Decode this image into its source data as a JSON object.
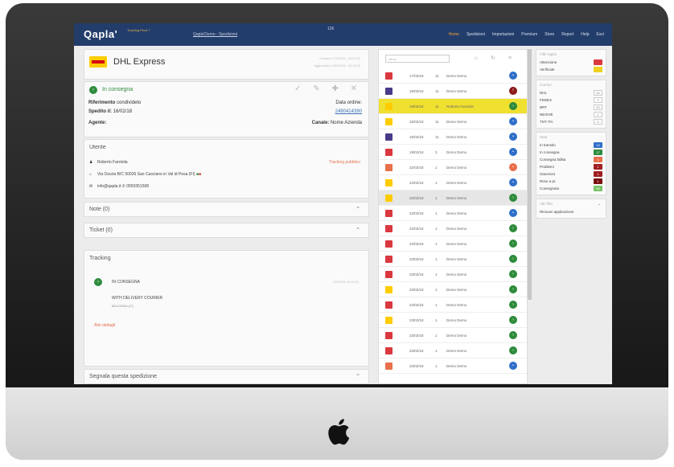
{
  "app": {
    "logo": "Qapla'",
    "logo_sub": "Tracking Pivot 7",
    "breadcrumb": "Qapla'Demo - Spedizioni",
    "user_no": "126",
    "nav": [
      "Home",
      "Spedizioni",
      "Importazioni",
      "Premium",
      "Store",
      "Report",
      "Help",
      "Esci"
    ]
  },
  "courier": {
    "name": "DHL Express",
    "meta_line1": "Creata il 17/02/18 - 15:37:00",
    "meta_line2": "Aggiornata il 22/02/18 - 10:15:11"
  },
  "shipment": {
    "status": "In consegna",
    "tools": "✓ ✎ ✚ ✕",
    "ref_label": "Riferimento",
    "ref_value": "condivideto",
    "shipped_label": "Spedito il:",
    "shipped_value": "16/02/18",
    "agent_label": "Agente:",
    "order_date_label": "Data ordine:",
    "order_date_value": "2490414390",
    "channel_label": "Canale:",
    "channel_value": "Nome Azienda"
  },
  "user": {
    "title": "Utente",
    "name": "Roberto Farotola",
    "address": "Via Ozuria B/C 50026 San Casciano in Val di Pesa (FI)",
    "email": "info@qapla.it",
    "phone": "0550351508",
    "tracking_link": "Tracking pubblico"
  },
  "notes": {
    "title": "Note (0)"
  },
  "ticket": {
    "title": "Ticket (0)"
  },
  "tracking": {
    "title": "Tracking",
    "status": "IN CONSEGNA",
    "date": "22/02/18 10:15:11",
    "desc": "WITH DELIVERY COURIER",
    "location": "BOLOGNA (IT)",
    "more": "Altri dettagli"
  },
  "report_section": {
    "title": "Segnala questa spedizione"
  },
  "list": {
    "search_placeholder": "cerca",
    "tools": "⌂ ↻ ≡",
    "rows": [
      {
        "date": "17/02/18",
        "n": "11",
        "name": "Demo Demo",
        "logo": "#d9383e",
        "status": "#2f6fc9",
        "icon": "•"
      },
      {
        "date": "18/02/18",
        "n": "11",
        "name": "Demo Demo",
        "logo": "#4a3a8a",
        "status": "#8b1a1a",
        "icon": "!"
      },
      {
        "date": "18/02/18",
        "n": "11",
        "name": "Roberto Farotola",
        "logo": "#ffcc00",
        "status": "#2e8b3c",
        "icon": "›",
        "selected": true
      },
      {
        "date": "15/02/18",
        "n": "11",
        "name": "Demo Demo",
        "logo": "#ffcc00",
        "status": "#2f6fc9",
        "icon": "•"
      },
      {
        "date": "16/02/18",
        "n": "11",
        "name": "Demo Demo",
        "logo": "#4a3a8a",
        "status": "#2f6fc9",
        "icon": "•"
      },
      {
        "date": "19/02/18",
        "n": "3",
        "name": "Demo Demo",
        "logo": "#d9383e",
        "status": "#2f6fc9",
        "icon": "•"
      },
      {
        "date": "22/02/18",
        "n": "1",
        "name": "Demo Demo",
        "logo": "#e8704a",
        "status": "#e8704a",
        "icon": "•"
      },
      {
        "date": "22/02/18",
        "n": "1",
        "name": "Demo Demo",
        "logo": "#ffcc00",
        "status": "#2f6fc9",
        "icon": "•"
      },
      {
        "date": "22/02/18",
        "n": "1",
        "name": "Demo Demo",
        "logo": "#ffcc00",
        "status": "#2e8b3c",
        "icon": "›",
        "hover": true
      },
      {
        "date": "22/02/18",
        "n": "1",
        "name": "Demo Demo",
        "logo": "#d9383e",
        "status": "#2f6fc9",
        "icon": "•"
      },
      {
        "date": "22/02/18",
        "n": "1",
        "name": "Demo Demo",
        "logo": "#d9383e",
        "status": "#2e8b3c",
        "icon": "›"
      },
      {
        "date": "22/02/18",
        "n": "1",
        "name": "Demo Demo",
        "logo": "#d9383e",
        "status": "#2e8b3c",
        "icon": "›"
      },
      {
        "date": "23/02/18",
        "n": "1",
        "name": "Demo Demo",
        "logo": "#d9383e",
        "status": "#2e8b3c",
        "icon": "›"
      },
      {
        "date": "23/02/18",
        "n": "1",
        "name": "Demo Demo",
        "logo": "#d9383e",
        "status": "#2e8b3c",
        "icon": "›"
      },
      {
        "date": "23/02/18",
        "n": "1",
        "name": "Demo Demo",
        "logo": "#ffcc00",
        "status": "#2e8b3c",
        "icon": "›"
      },
      {
        "date": "23/02/18",
        "n": "1",
        "name": "Demo Demo",
        "logo": "#d9383e",
        "status": "#2e8b3c",
        "icon": "›"
      },
      {
        "date": "23/02/18",
        "n": "1",
        "name": "Demo Demo",
        "logo": "#ffcc00",
        "status": "#2e8b3c",
        "icon": "›"
      },
      {
        "date": "23/02/18",
        "n": "1",
        "name": "Demo Demo",
        "logo": "#d9383e",
        "status": "#2e8b3c",
        "icon": "›"
      },
      {
        "date": "23/02/18",
        "n": "1",
        "name": "Demo Demo",
        "logo": "#d9383e",
        "status": "#2e8b3c",
        "icon": "›"
      },
      {
        "date": "23/02/18",
        "n": "1",
        "name": "Demo Demo",
        "logo": "#e8704a",
        "status": "#2f6fc9",
        "icon": "•"
      }
    ]
  },
  "filters": {
    "p1_title": "Filtri rapidi",
    "p1": [
      {
        "label": "Attenzione",
        "color": "#d9383e"
      },
      {
        "label": "Verificate",
        "color": "#f0d020"
      }
    ],
    "p2_title": "Corrieri",
    "p2": [
      {
        "label": "DHL",
        "count": "11"
      },
      {
        "label": "FEDEX",
        "count": "7"
      },
      {
        "label": "BRT",
        "count": "22"
      },
      {
        "label": "NEXIVE",
        "count": "1"
      },
      {
        "label": "TNT ITA",
        "count": "1"
      }
    ],
    "p3_title": "Stati",
    "p3": [
      {
        "label": "In transito",
        "color": "#2f6fc9",
        "value": "13"
      },
      {
        "label": "In consegna",
        "color": "#2e8b3c",
        "value": "17"
      },
      {
        "label": "Consegna fallita",
        "color": "#e8704a",
        "value": "1"
      },
      {
        "label": "Problemi",
        "color": "#a01e1e",
        "value": "1"
      },
      {
        "label": "Giacenza",
        "color": "#a01e1e",
        "value": "1"
      },
      {
        "label": "Reso a pr.",
        "color": "#7a1010",
        "value": "1"
      },
      {
        "label": "Consegnato",
        "color": "#7ac36a",
        "value": "48"
      }
    ],
    "p4_title": "Altri filtri",
    "p4_item": "Rimuovi applicazione"
  },
  "fab_label": "☰"
}
